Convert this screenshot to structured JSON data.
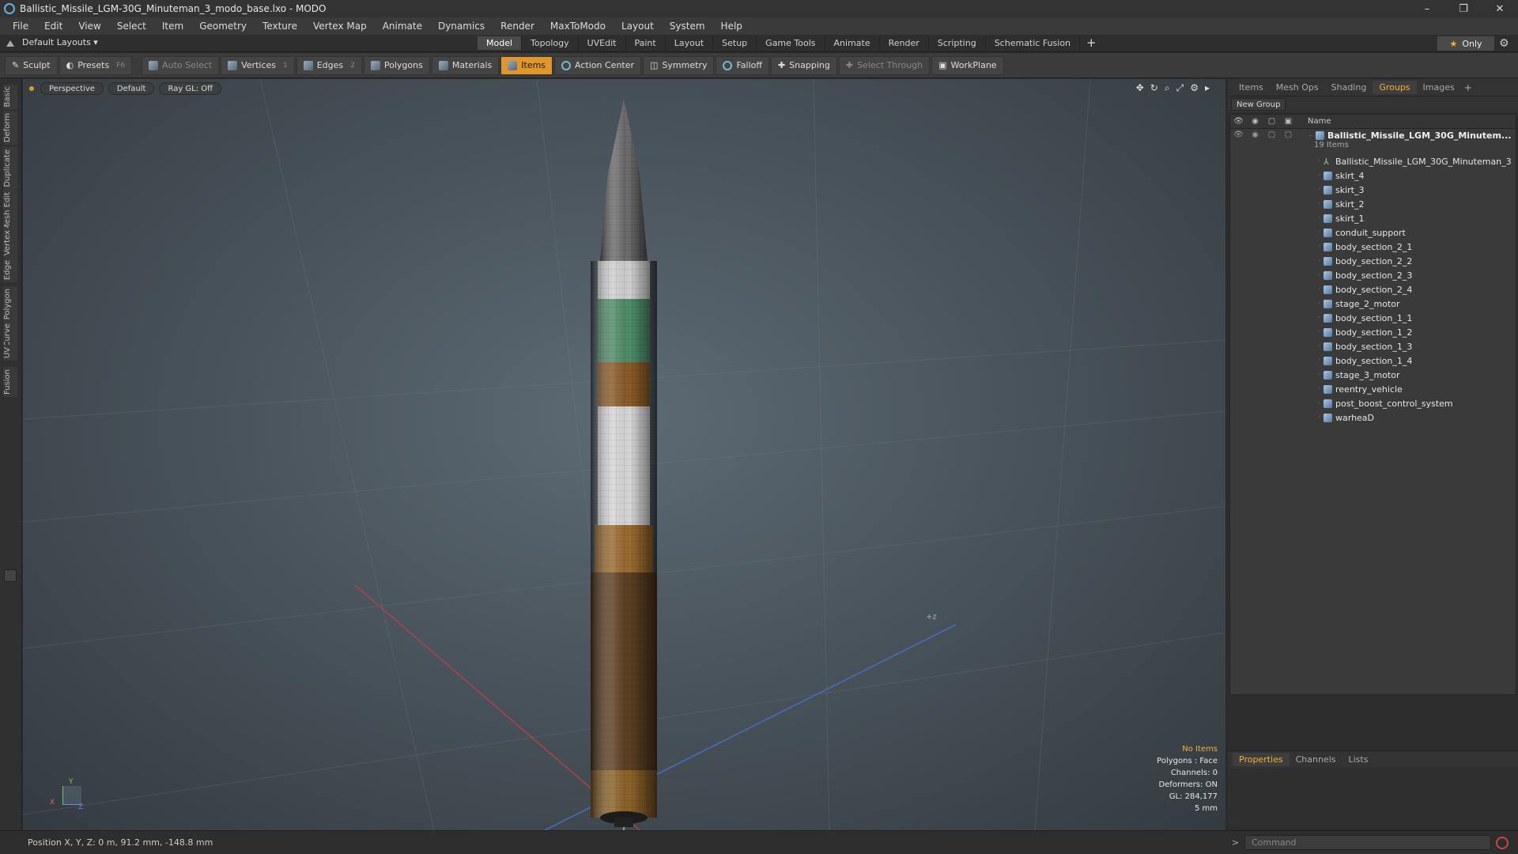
{
  "window": {
    "title": "Ballistic_Missile_LGM-30G_Minuteman_3_modo_base.lxo - MODO",
    "controls": [
      "–",
      "❐",
      "✕"
    ]
  },
  "menu": [
    "File",
    "Edit",
    "View",
    "Select",
    "Item",
    "Geometry",
    "Texture",
    "Vertex Map",
    "Animate",
    "Dynamics",
    "Render",
    "MaxToModo",
    "Layout",
    "System",
    "Help"
  ],
  "layout": {
    "selector": "Default Layouts ▾"
  },
  "main_tabs": [
    {
      "label": "Model",
      "active": true
    },
    {
      "label": "Topology"
    },
    {
      "label": "UVEdit"
    },
    {
      "label": "Paint"
    },
    {
      "label": "Layout"
    },
    {
      "label": "Setup"
    },
    {
      "label": "Game Tools"
    },
    {
      "label": "Animate"
    },
    {
      "label": "Render"
    },
    {
      "label": "Scripting"
    },
    {
      "label": "Schematic Fusion"
    }
  ],
  "tab_plus": "+",
  "only_label": "Only",
  "toolbar": {
    "sculpt": "Sculpt",
    "presets": "Presets",
    "presets_key": "F6",
    "auto_select": "Auto Select",
    "vertices": "Vertices",
    "vertices_key": "1",
    "edges": "Edges",
    "edges_key": "2",
    "polygons": "Polygons",
    "materials": "Materials",
    "items": "Items",
    "action_center": "Action Center",
    "symmetry": "Symmetry",
    "falloff": "Falloff",
    "snapping": "Snapping",
    "select_through": "Select Through",
    "workplane": "WorkPlane"
  },
  "left_tabs": [
    "Basic",
    "Deform",
    "Duplicate",
    "Mesh Edit",
    "Vertex",
    "Edge",
    "Polygon",
    "Curve",
    "UV",
    "Fusion"
  ],
  "viewport": {
    "view": "Perspective",
    "shading": "Default",
    "raygl": "Ray GL: Off",
    "info": {
      "selection": "No Items",
      "polygons": "Polygons : Face",
      "channels": "Channels: 0",
      "deformers": "Deformers: ON",
      "gl": "GL: 284,177",
      "scale": "5 mm"
    },
    "axis": {
      "x": "X",
      "y": "Y",
      "z": "Z"
    }
  },
  "right_panel": {
    "tabs": [
      {
        "label": "Items"
      },
      {
        "label": "Mesh Ops"
      },
      {
        "label": "Shading"
      },
      {
        "label": "Groups",
        "active": true
      },
      {
        "label": "Images"
      }
    ],
    "new_group": "New Group",
    "column_name": "Name",
    "group": {
      "name": "Ballistic_Missile_LGM_30G_Minutem...",
      "count": "19 Items"
    },
    "items": [
      {
        "label": "Ballistic_Missile_LGM_30G_Minuteman_3",
        "kind": "locator"
      },
      {
        "label": "skirt_4"
      },
      {
        "label": "skirt_3"
      },
      {
        "label": "skirt_2"
      },
      {
        "label": "skirt_1"
      },
      {
        "label": "conduit_support"
      },
      {
        "label": "body_section_2_1"
      },
      {
        "label": "body_section_2_2"
      },
      {
        "label": "body_section_2_3"
      },
      {
        "label": "body_section_2_4"
      },
      {
        "label": "stage_2_motor"
      },
      {
        "label": "body_section_1_1"
      },
      {
        "label": "body_section_1_2"
      },
      {
        "label": "body_section_1_3"
      },
      {
        "label": "body_section_1_4"
      },
      {
        "label": "stage_3_motor"
      },
      {
        "label": "reentry_vehicle"
      },
      {
        "label": "post_boost_control_system"
      },
      {
        "label": "warheaD"
      }
    ],
    "props_tabs": [
      {
        "label": "Properties",
        "active": true
      },
      {
        "label": "Channels"
      },
      {
        "label": "Lists"
      }
    ]
  },
  "status": {
    "position": "Position X, Y, Z:  0 m, 91.2 mm, -148.8 mm",
    "command_placeholder": "Command"
  }
}
